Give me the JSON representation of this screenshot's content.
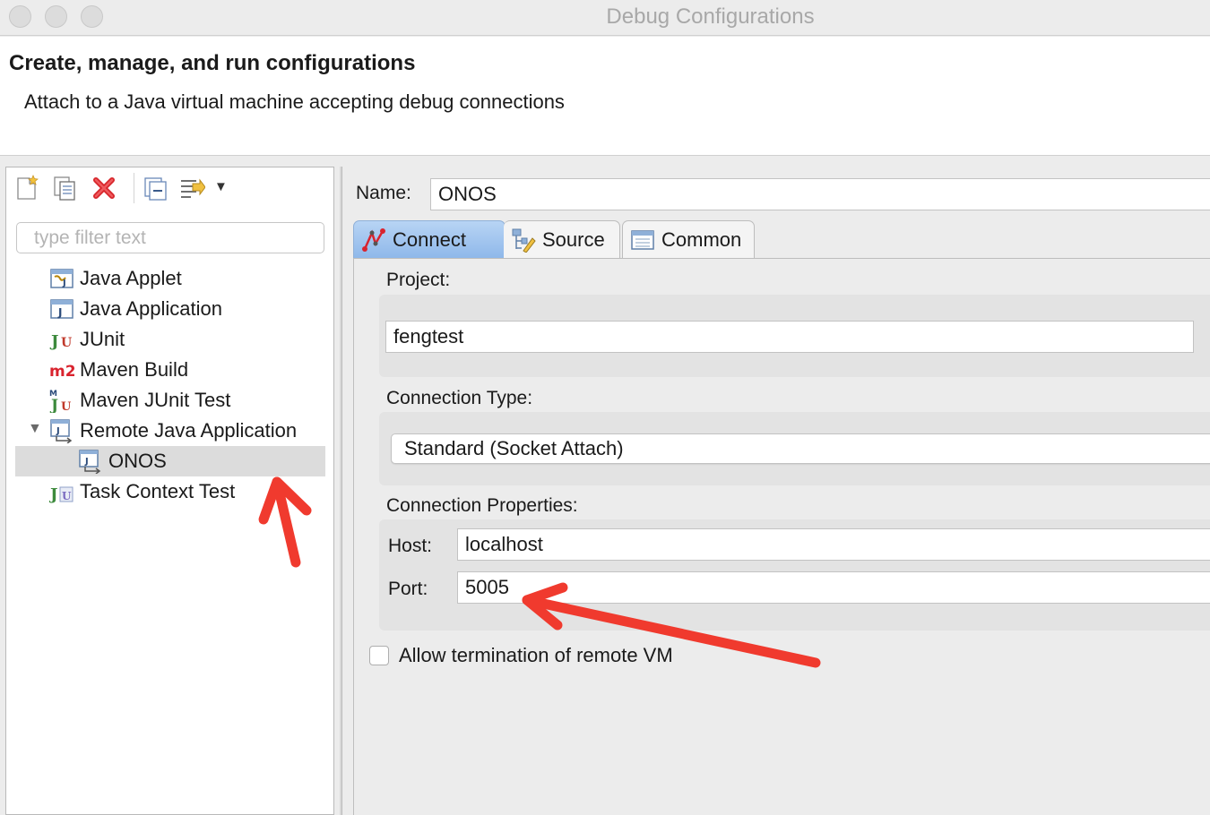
{
  "window": {
    "title": "Debug Configurations"
  },
  "header": {
    "title": "Create, manage, and run configurations",
    "description": "Attach to a Java virtual machine accepting debug connections"
  },
  "toolbar": {
    "buttons": [
      "new-launch-config-icon",
      "duplicate-icon",
      "delete-icon",
      "collapse-all-icon",
      "filter-icon",
      "dropdown-arrow-icon"
    ]
  },
  "filter": {
    "placeholder": "type filter text",
    "value": ""
  },
  "tree": {
    "items": [
      {
        "label": "Java Applet",
        "icon": "java-applet-icon"
      },
      {
        "label": "Java Application",
        "icon": "java-application-icon"
      },
      {
        "label": "JUnit",
        "icon": "junit-icon"
      },
      {
        "label": "Maven Build",
        "icon": "maven-icon"
      },
      {
        "label": "Maven JUnit Test",
        "icon": "maven-junit-icon"
      },
      {
        "label": "Remote Java Application",
        "icon": "remote-java-icon",
        "expanded": true
      },
      {
        "label": "ONOS",
        "icon": "remote-java-icon",
        "selected": true
      },
      {
        "label": "Task Context Test",
        "icon": "task-context-icon"
      }
    ]
  },
  "config": {
    "name_label": "Name:",
    "name_value": "ONOS",
    "tabs": [
      {
        "label": "Connect",
        "active": true
      },
      {
        "label": "Source",
        "active": false
      },
      {
        "label": "Common",
        "active": false
      }
    ],
    "project_label": "Project:",
    "project_value": "fengtest",
    "connection_type_label": "Connection Type:",
    "connection_type_value": "Standard (Socket Attach)",
    "connection_properties_label": "Connection Properties:",
    "host_label": "Host:",
    "host_value": "localhost",
    "port_label": "Port:",
    "port_value": "5005",
    "allow_termination_label": "Allow termination of remote VM",
    "allow_termination_checked": false
  },
  "colors": {
    "accent_tab": "#8fb8ea",
    "annotation_arrow": "#f03a2e",
    "selection": "#dcdcdc"
  }
}
